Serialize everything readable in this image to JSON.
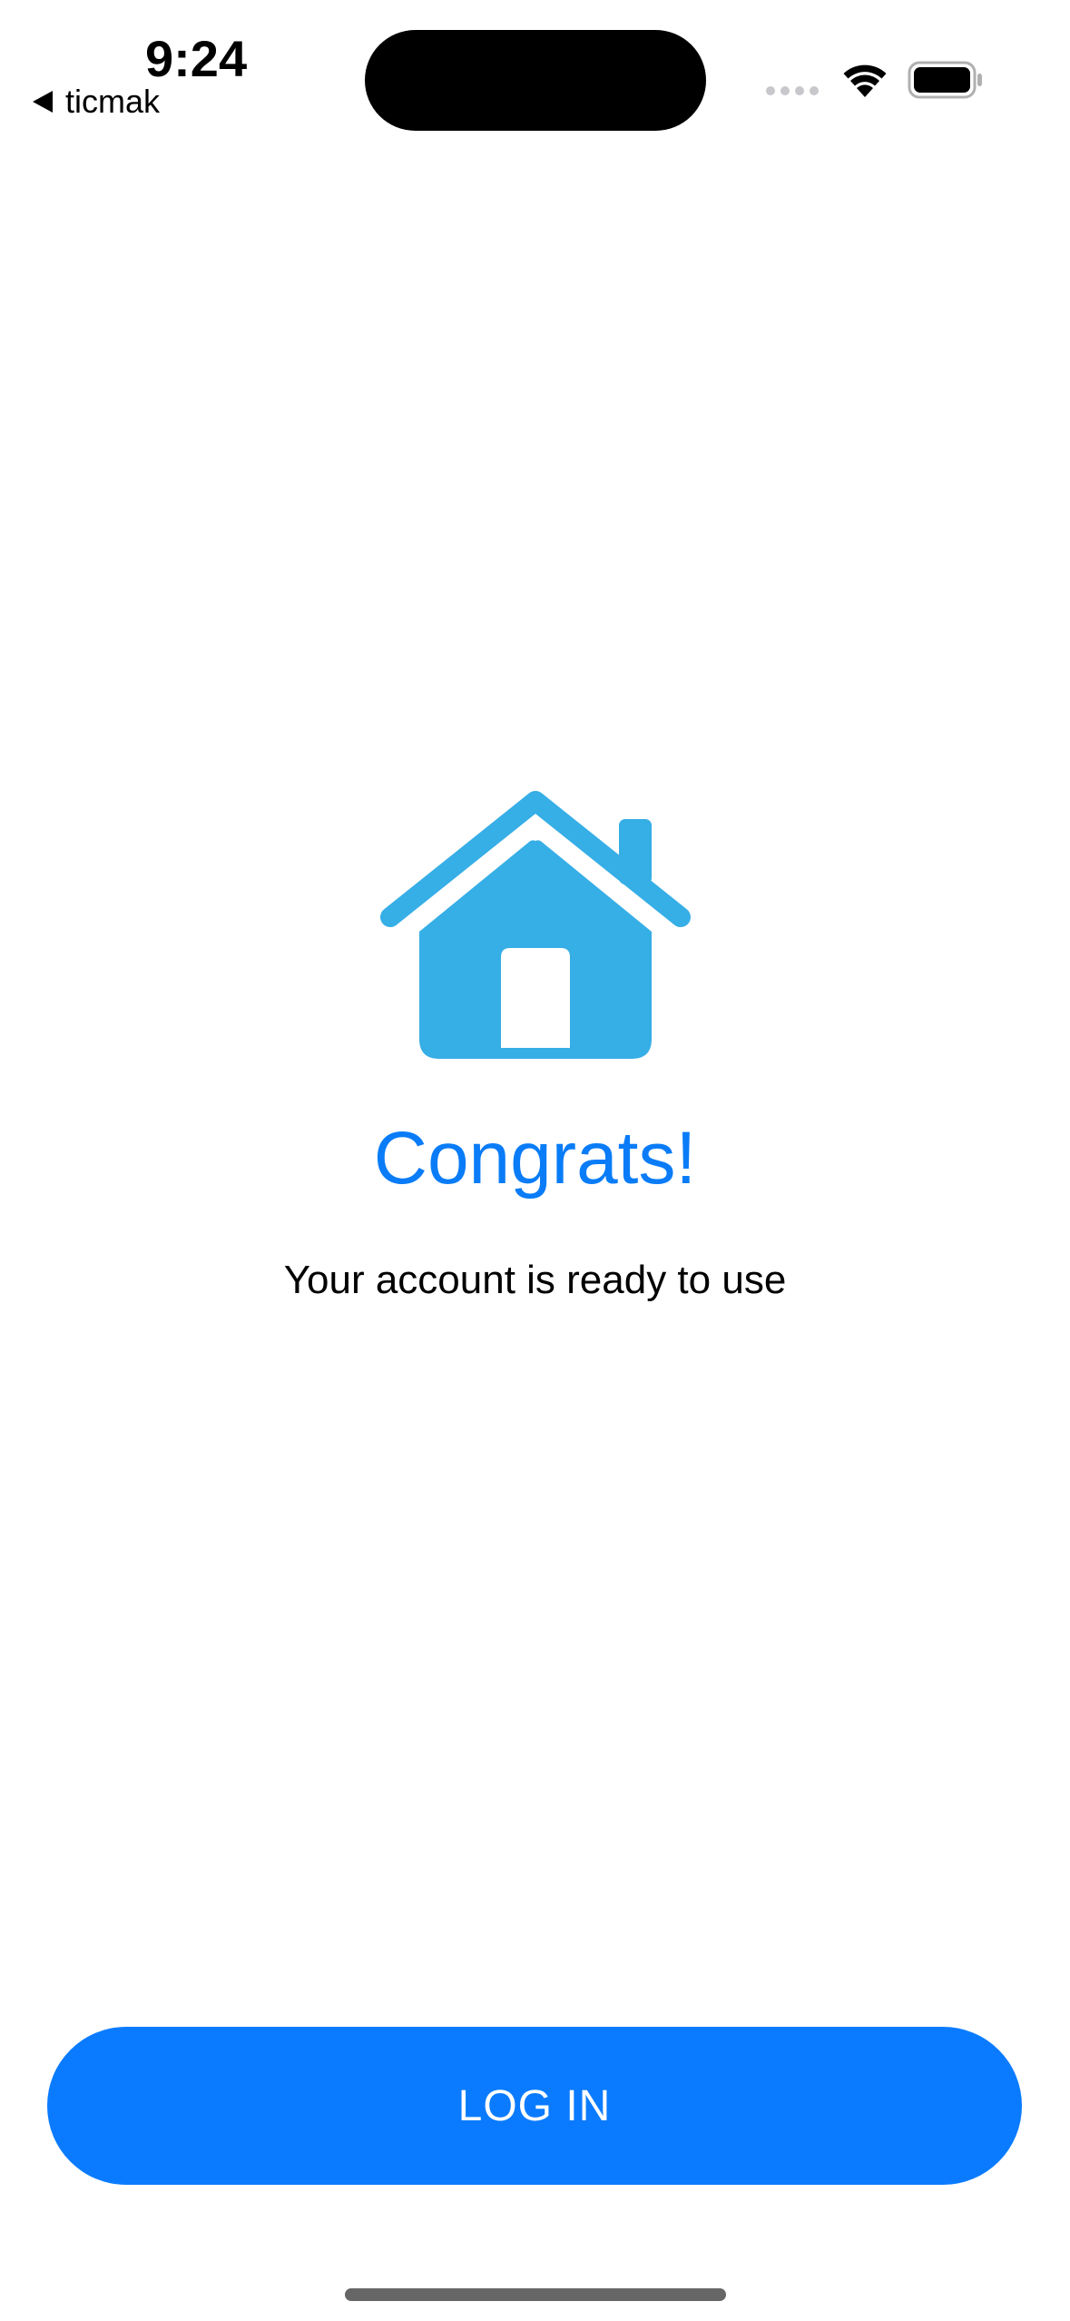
{
  "status_bar": {
    "time": "9:24",
    "back_app_label": "ticmak"
  },
  "main": {
    "icon": "house-icon",
    "title": "Congrats!",
    "subtitle": "Your account is ready to use"
  },
  "actions": {
    "login_label": "LOG IN"
  },
  "colors": {
    "accent": "#0a7bff",
    "title": "#0a7cf7",
    "icon": "#36aee6",
    "background": "#ffffff"
  }
}
